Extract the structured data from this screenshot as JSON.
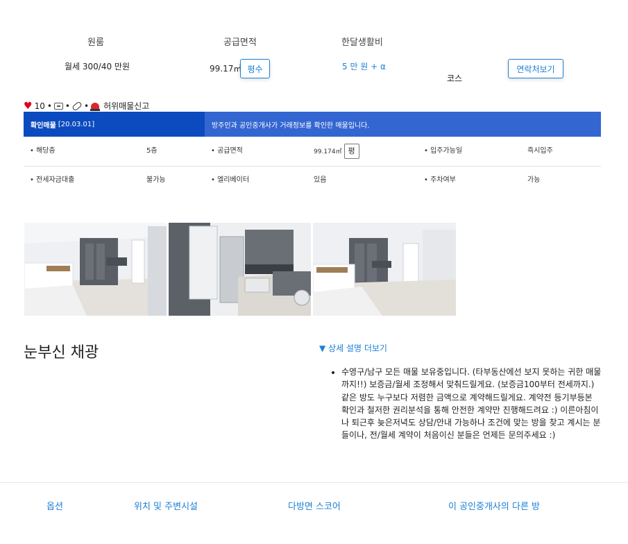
{
  "summary": {
    "type_label": "원룸",
    "price": "월세 300/40 만원",
    "area_label": "공급면적",
    "area_value": "99.17㎡",
    "area_toggle": "평수",
    "living_label": "한달생활비",
    "living_value": "5 만 원 + α",
    "course": "코스",
    "contact_button": "연락처보기"
  },
  "stats": {
    "likes": "10",
    "report": "허위매물신고"
  },
  "banner": {
    "verified": "확인매물",
    "verified_date": "[20.03.01]",
    "message": "방주인과 공인중개사가 거래정보를 확인한 매물입니다."
  },
  "details": {
    "row1": {
      "floor_label": "• 해당층",
      "floor_value": "5층",
      "area_label": "• 공급면적",
      "area_value": "99.174㎡",
      "area_toggle": "평",
      "move_label": "• 입주가능일",
      "move_value": "즉시입주"
    },
    "row2": {
      "loan_label": "• 전세자금대출",
      "loan_value": "불가능",
      "elevator_label": "• 엘리베이터",
      "elevator_value": "있음",
      "parking_label": "• 주차여부",
      "parking_value": "가능"
    }
  },
  "photos": [
    "room-photo-1",
    "room-photo-2",
    "room-photo-3"
  ],
  "description": {
    "title": "눈부신 채광",
    "more": "▼ 상세 설명 더보기",
    "body": "수영구/남구 모든 매물 보유중입니다. (타부동산에선 보지 못하는 귀한 매물까지!!) 보증금/월세 조정해서 맞춰드릴게요. (보증금100부터 전세까지.) 같은 방도 누구보다 저렴한 금액으로 계약해드릴게요. 계약전 등기부등본 확인과 철저한 권리분석을 통해 안전한 계약만 진행해드려요 :) 이른아침이나 퇴근후 늦은저녁도 상담/안내 가능하나 조건에 맞는 방을 찾고 계시는 분들이나, 전/월세 계약이 처음이신 분들은 언제든 문의주세요 :)"
  },
  "bottom_nav": {
    "options": "옵션",
    "location": "위치 및 주변시설",
    "score": "다방면 스코어",
    "agent_rooms": "이 공인중개사의 다른 방"
  }
}
